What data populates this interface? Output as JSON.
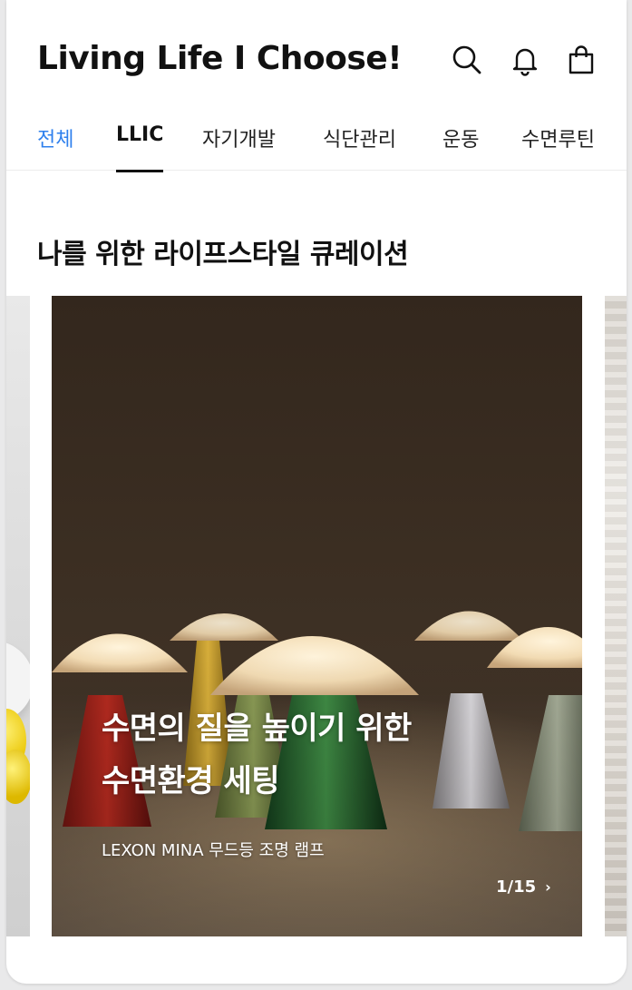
{
  "header": {
    "title": "Living Life I Choose!",
    "icons": [
      "search-icon",
      "bell-icon",
      "shopping-bag-icon"
    ]
  },
  "tabs": [
    {
      "label": "전체"
    },
    {
      "label": "LLIC"
    },
    {
      "label": "자기개발"
    },
    {
      "label": "식단관리"
    },
    {
      "label": "운동"
    },
    {
      "label": "수면루틴"
    }
  ],
  "section": {
    "title": "나를 위한 라이프스타일 큐레이션"
  },
  "carousel": {
    "headline_line1": "수면의 질을 높이기 위한",
    "headline_line2": "수면환경 세팅",
    "product": "LEXON MINA 무드등 조명 램프",
    "pager": "1/15",
    "pager_icon": "chevron-right-icon"
  },
  "colors": {
    "accent": "#2f80ed",
    "text": "#111111",
    "background": "#ffffff"
  }
}
